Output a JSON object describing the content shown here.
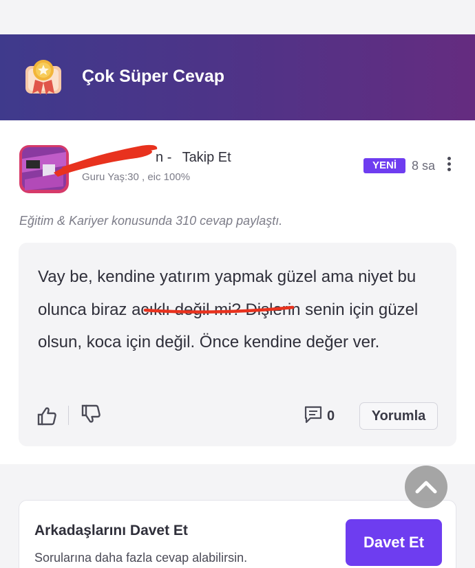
{
  "banner": {
    "title": "Çok Süper Cevap",
    "badge_icon": "medal-icon",
    "gradient_start": "#3f3a8c",
    "gradient_end": "#652c80"
  },
  "answer": {
    "username_visible": "n",
    "separator": "-",
    "follow_label": "Takip Et",
    "user_meta": "Guru Yaş:30 , eic 100%",
    "new_badge": "YENİ",
    "time": "8 sa",
    "topic_line": "Eğitim & Kariyer konusunda 310 cevap paylaştı.",
    "text": "Vay be, kendine yatırım yapmak güzel ama niyet bu olunca biraz acıklı değil mi? Dişlerin senin için güzel olsun, koca için değil. Önce kendine değer ver.",
    "comment_count": "0",
    "reply_label": "Yorumla"
  },
  "invite": {
    "title": "Arkadaşlarını Davet Et",
    "subtitle": "Sorularına daha fazla cevap alabilirsin.",
    "button_label": "Davet Et"
  },
  "colors": {
    "accent": "#6e3df0",
    "redaction": "#e8321e"
  }
}
